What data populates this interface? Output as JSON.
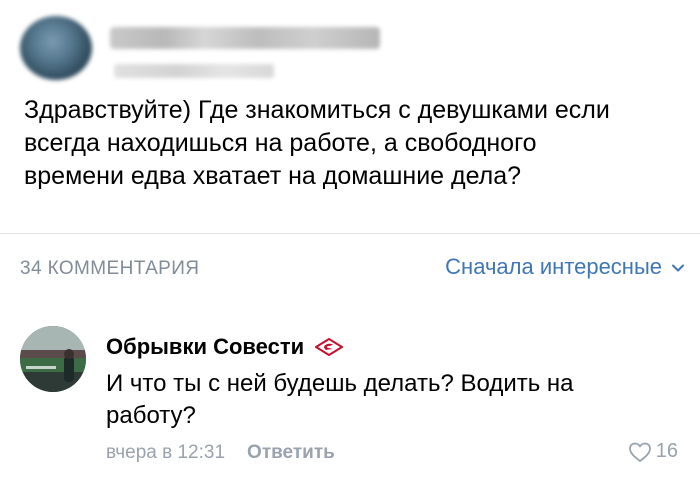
{
  "post": {
    "text": "Здравствуйте) Где знакомиться с девушками если\nвсегда находишься на работе, а свободного\nвремени едва хватает на домашние дела?"
  },
  "comments_header": {
    "count_label": "34 КОММЕНТАРИЯ",
    "sort_label": "Сначала интересные"
  },
  "comment": {
    "author": "Обрывки Совести",
    "text": "И что ты с ней будешь делать? Водить на работу?",
    "time": "вчера в 12:31",
    "reply_label": "Ответить",
    "likes": "16"
  },
  "colors": {
    "link": "#3f76b6",
    "secondary": "#818c99",
    "badge": "#c8102e"
  },
  "icons": {
    "sort": "chevron-down-icon",
    "badge": "spartak-logo-icon",
    "like": "heart-outline-icon"
  }
}
